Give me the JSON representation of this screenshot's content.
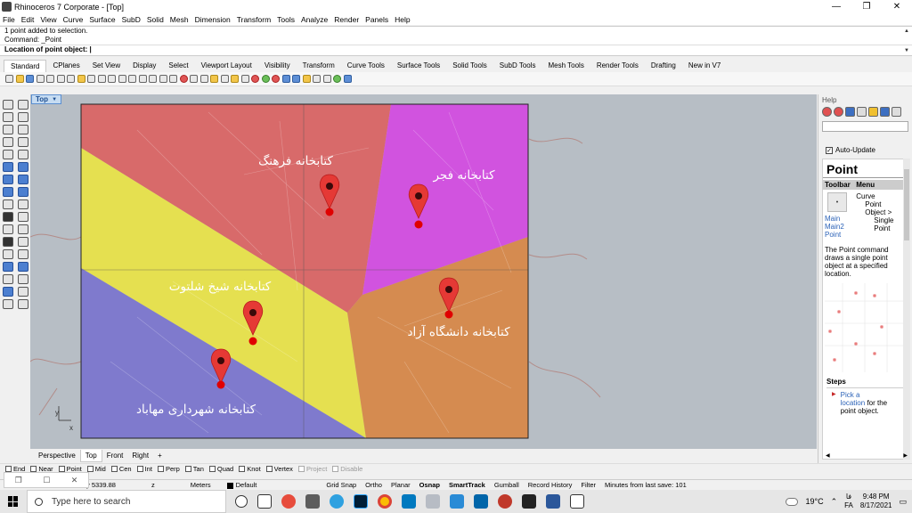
{
  "window": {
    "title": "Rhinoceros 7 Corporate - [Top]",
    "minimize": "—",
    "maximize": "❐",
    "close": "✕"
  },
  "menu": [
    "File",
    "Edit",
    "View",
    "Curve",
    "Surface",
    "SubD",
    "Solid",
    "Mesh",
    "Dimension",
    "Transform",
    "Tools",
    "Analyze",
    "Render",
    "Panels",
    "Help"
  ],
  "command": {
    "history1": "1 point added to selection.",
    "history2": "Command: _Point",
    "prompt": "Location of point object:"
  },
  "toolbar_tabs": [
    "Standard",
    "CPlanes",
    "Set View",
    "Display",
    "Select",
    "Viewport Layout",
    "Visibility",
    "Transform",
    "Curve Tools",
    "Surface Tools",
    "Solid Tools",
    "SubD Tools",
    "Mesh Tools",
    "Render Tools",
    "Drafting",
    "New in V7"
  ],
  "viewport": {
    "label": "Top",
    "axis_x": "x",
    "axis_y": "y",
    "regions": [
      {
        "name": "Farhang",
        "color": "#d96565"
      },
      {
        "name": "Fajr",
        "color": "#d24de0"
      },
      {
        "name": "Shaltout",
        "color": "#e7e24a"
      },
      {
        "name": "Azad",
        "color": "#d6884a"
      },
      {
        "name": "Mahabad",
        "color": "#7b76cd"
      }
    ],
    "labels": {
      "farhang": "کتابخانه فرهنگ",
      "fajr": "کتابخانه فجر",
      "shaltout": "کتابخانه شیخ شلتوت",
      "azad": "کتابخانه دانشگاه آزاد",
      "mahabad": "کتابخانه شهرداری مهاباد"
    },
    "tabs": [
      "Perspective",
      "Top",
      "Front",
      "Right"
    ]
  },
  "panel": {
    "header": "Help",
    "auto_update": "Auto-Update",
    "title": "Point",
    "col_toolbar": "Toolbar",
    "col_menu": "Menu",
    "toolbar_links": [
      "Main",
      "Main2",
      "Point"
    ],
    "menu_path": [
      "Curve",
      "Point",
      "Object >",
      "Single",
      "Point"
    ],
    "description": "The Point command draws a single point object at a specified location.",
    "steps_title": "Steps",
    "step1_link1": "Pick a",
    "step1_link2": "location",
    "step1_rest": "for the point object."
  },
  "osnaps": [
    {
      "label": "End",
      "enabled": true
    },
    {
      "label": "Near",
      "enabled": true
    },
    {
      "label": "Point",
      "enabled": true
    },
    {
      "label": "Mid",
      "enabled": true
    },
    {
      "label": "Cen",
      "enabled": true
    },
    {
      "label": "Int",
      "enabled": true
    },
    {
      "label": "Perp",
      "enabled": true
    },
    {
      "label": "Tan",
      "enabled": true
    },
    {
      "label": "Quad",
      "enabled": true
    },
    {
      "label": "Knot",
      "enabled": true
    },
    {
      "label": "Vertex",
      "enabled": true
    },
    {
      "label": "Project",
      "enabled": false
    },
    {
      "label": "Disable",
      "enabled": false
    }
  ],
  "status": {
    "coord_y": "y 5339.88",
    "coord_z": "z",
    "units": "Meters",
    "layer": "Default",
    "grid_snap": "Grid Snap",
    "ortho": "Ortho",
    "planar": "Planar",
    "osnap": "Osnap",
    "smarttrack": "SmartTrack",
    "gumball": "Gumball",
    "record_history": "Record History",
    "filter": "Filter",
    "last_save": "Minutes from last save: 101"
  },
  "taskbar": {
    "search_placeholder": "Type here to search",
    "weather": "19°C",
    "lang1": "فا",
    "lang2": "FA",
    "time": "9:48 PM",
    "date": "8/17/2021"
  }
}
